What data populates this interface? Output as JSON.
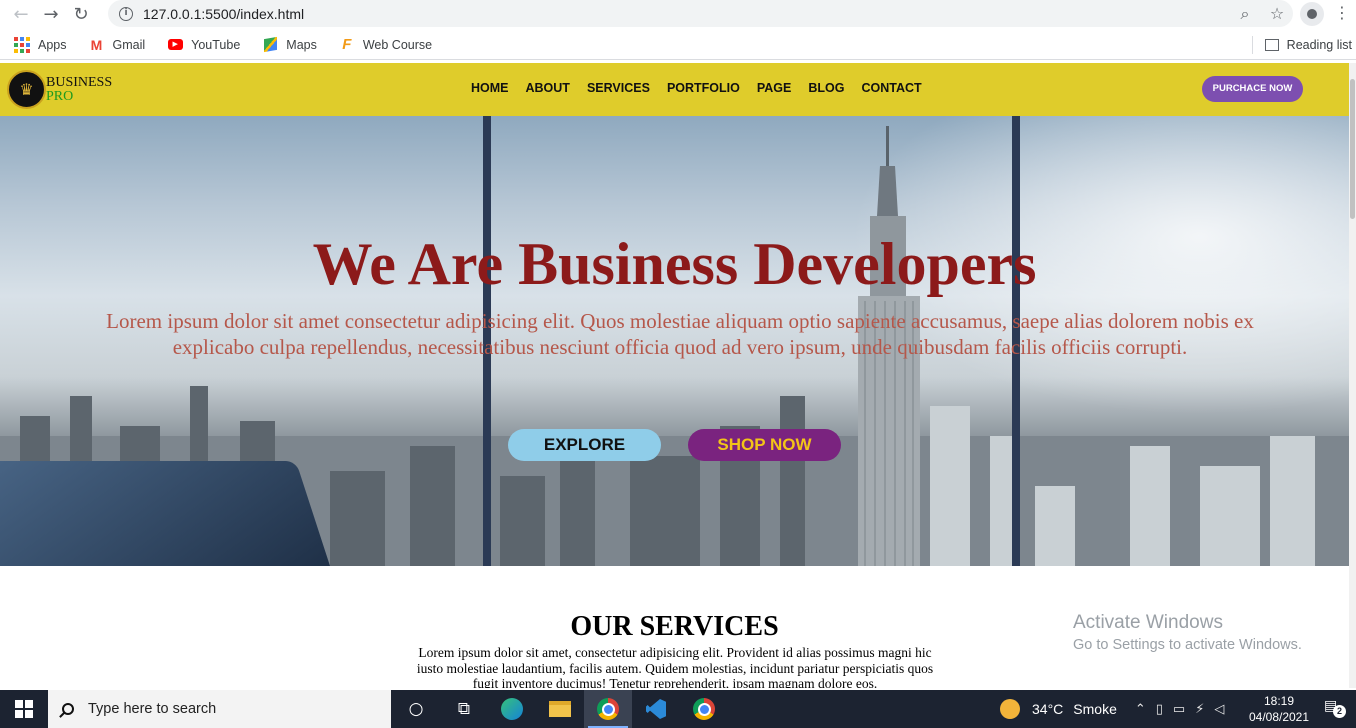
{
  "browser": {
    "url": "127.0.0.1:5500/index.html",
    "bookmarks": [
      {
        "label": "Apps"
      },
      {
        "label": "Gmail"
      },
      {
        "label": "YouTube"
      },
      {
        "label": "Maps"
      },
      {
        "label": "Web Course"
      }
    ],
    "reading_list": "Reading list"
  },
  "site": {
    "logo": {
      "line1": "BUSINESS",
      "line2": "PRO"
    },
    "menu": [
      "HOME",
      "ABOUT",
      "SERVICES",
      "PORTFOLIO",
      "PAGE",
      "BLOG",
      "CONTACT"
    ],
    "purchase_label": "PURCHACE NOW",
    "hero": {
      "title": "We Are Business Developers",
      "text": "Lorem ipsum dolor sit amet consectetur adipisicing elit. Quos molestiae aliquam optio sapiente accusamus, saepe alias dolorem nobis ex explicabo culpa repellendus, necessitatibus nesciunt officia quod ad vero ipsum, unde quibusdam facilis officiis corrupti.",
      "explore_label": "EXPLORE",
      "shop_label": "SHOP NOW"
    },
    "services": {
      "title": "OUR SERVICES",
      "text": "Lorem ipsum dolor sit amet, consectetur adipisicing elit. Provident id alias possimus magni hic iusto molestiae laudantium, facilis autem. Quidem molestias, incidunt pariatur perspiciatis quos fugit inventore ducimus! Tenetur reprehenderit, ipsam magnam dolore eos."
    },
    "colors": {
      "navbar": "#dfcc2b",
      "title": "#8c1a1a",
      "purchase": "#7d4fb0",
      "shop": "#7a237f",
      "explore": "#8fcde9"
    }
  },
  "watermark": {
    "line1": "Activate Windows",
    "line2": "Go to Settings to activate Windows."
  },
  "taskbar": {
    "search_placeholder": "Type here to search",
    "weather": {
      "temp": "34°C",
      "condition": "Smoke"
    },
    "time": "18:19",
    "date": "04/08/2021",
    "notifications": "2"
  }
}
